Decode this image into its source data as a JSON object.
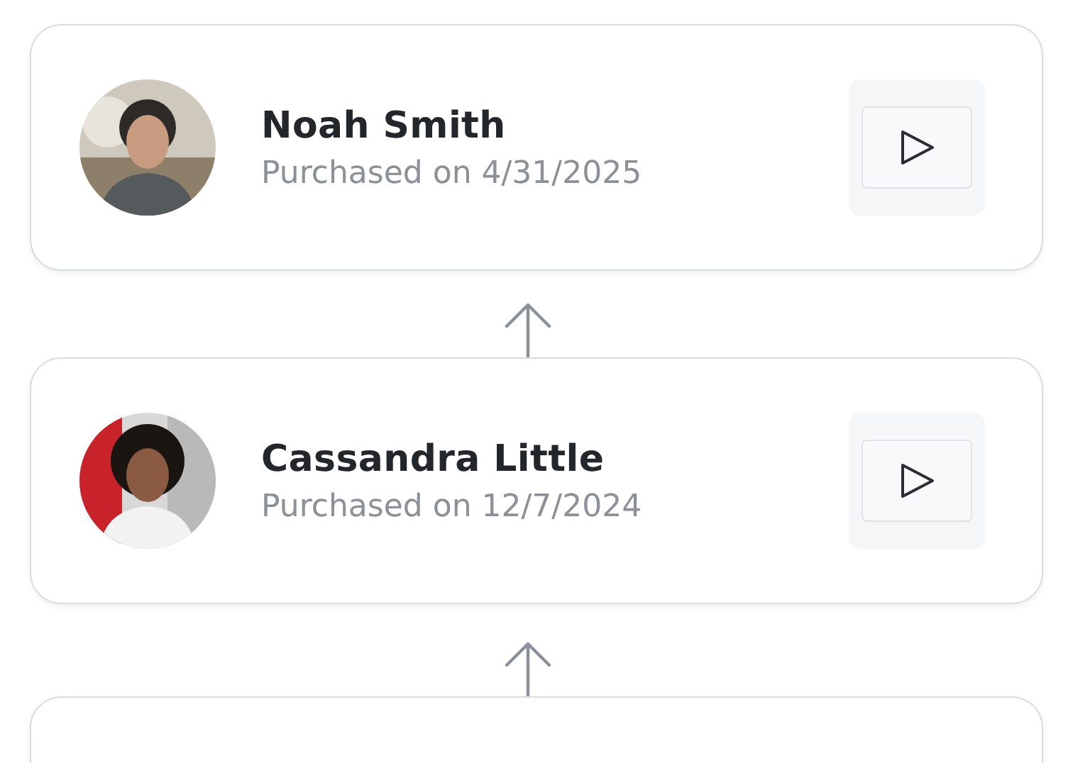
{
  "cards": [
    {
      "kind": "purchase",
      "name": "Noah Smith",
      "detail": "Purchased on 4/31/2025"
    },
    {
      "kind": "purchase",
      "name": "Cassandra Little",
      "detail": "Purchased on 12/7/2024"
    },
    {
      "kind": "partial"
    }
  ]
}
